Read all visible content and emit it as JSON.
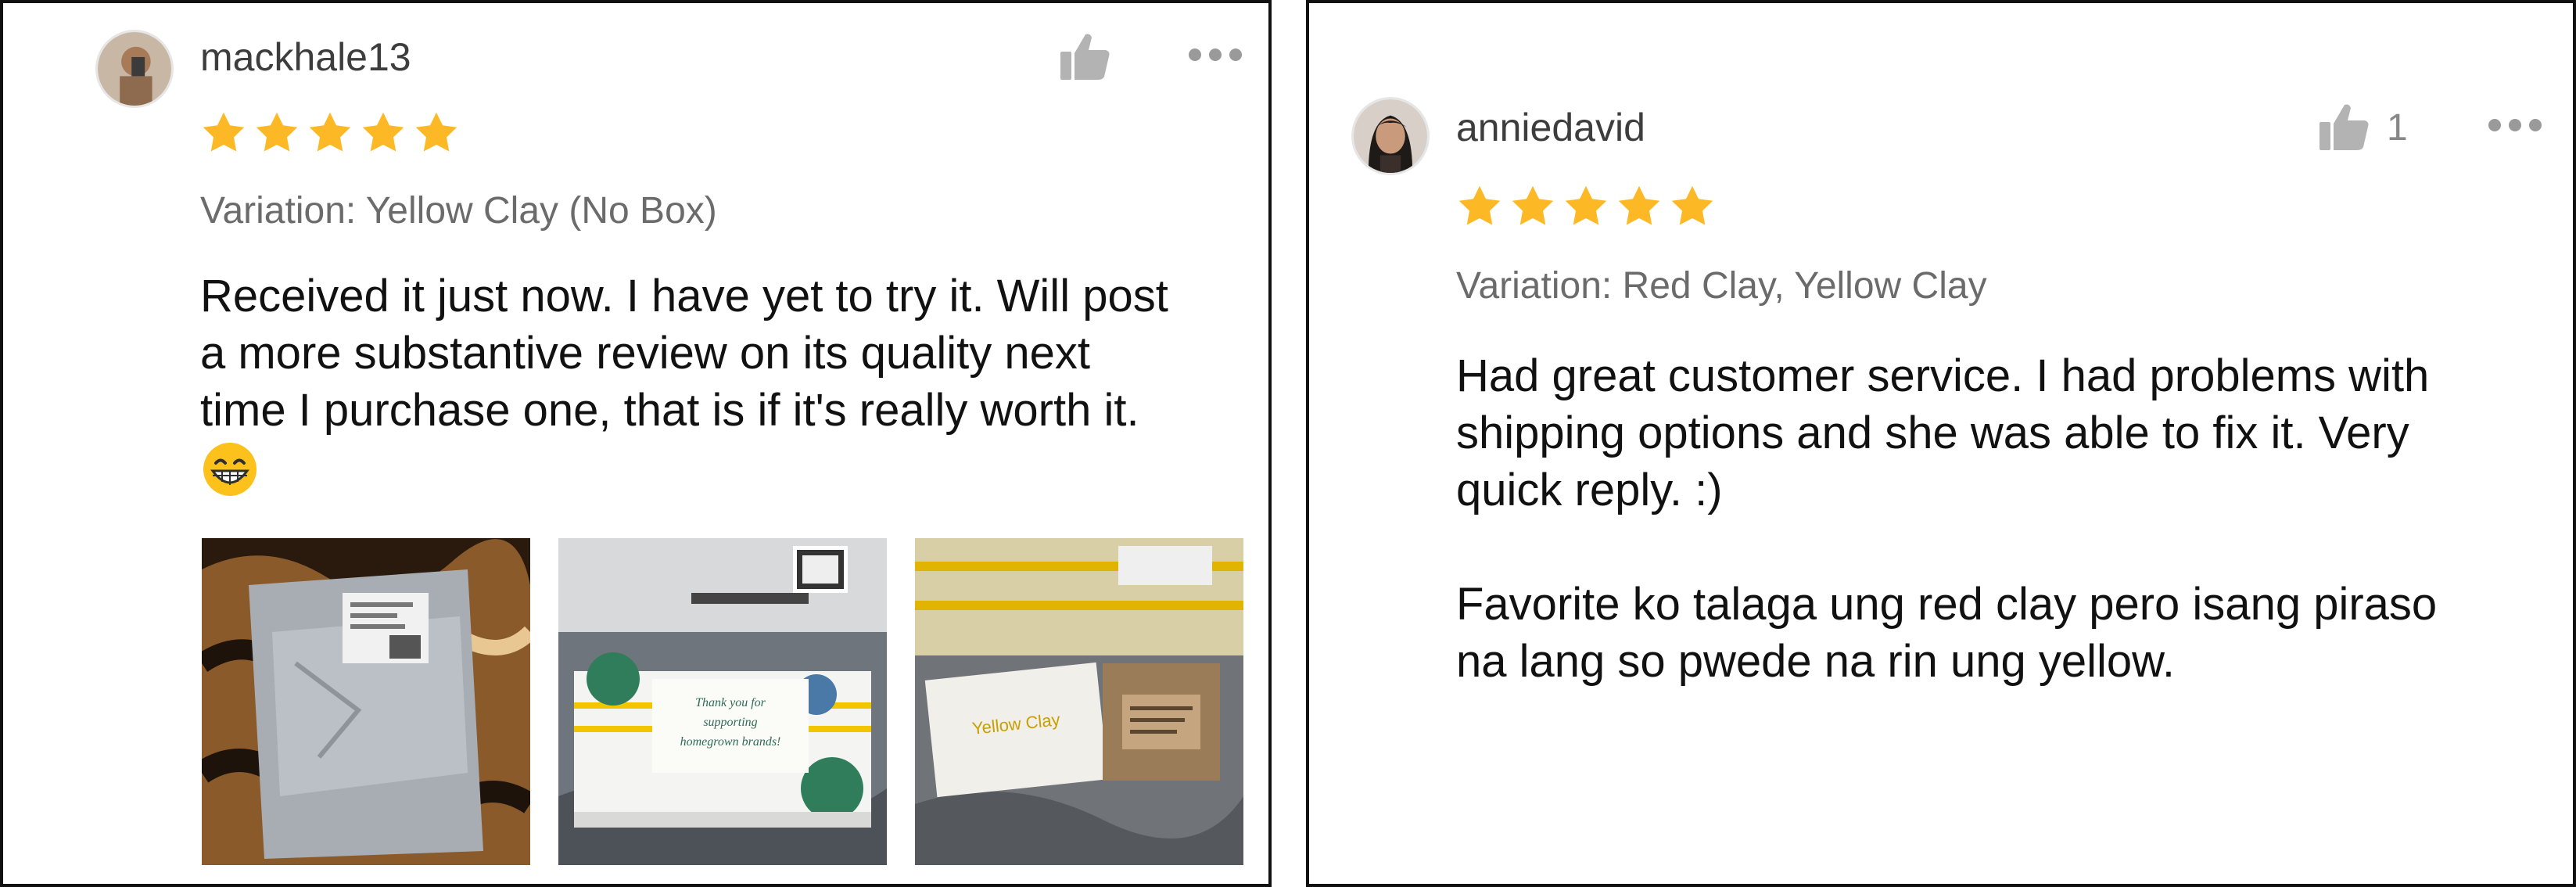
{
  "reviews": [
    {
      "username": "mackhale13",
      "rating": 5,
      "like_count": "",
      "variation": "Variation: Yellow Clay (No Box)",
      "text": "Received it just now. I have yet to try it. Will post\na more substantive review on its quality next\ntime I purchase one, that is if it's really worth it.",
      "emoji": "grinning-face-with-smiling-eyes",
      "photos": [
        {
          "name": "photo-silver-mailer-bag"
        },
        {
          "name": "photo-box-thank-you",
          "caption": "Thank you for supporting homegrown brands!"
        },
        {
          "name": "photo-yellow-clay-boxes",
          "caption": "Yellow Clay"
        }
      ]
    },
    {
      "username": "anniedavid",
      "rating": 5,
      "like_count": "1",
      "variation": "Variation: Red Clay, Yellow Clay",
      "text": "Had great customer service. I had problems with\nshipping options and she was able to fix it. Very\nquick reply. :)\n\nFavorite ko talaga ung red clay pero isang piraso\nna lang so pwede na rin ung yellow."
    }
  ],
  "colors": {
    "star": "#FDB925",
    "like_icon": "#b3b3b3",
    "username": "#3d3d3d",
    "variation": "#6b6b6b"
  }
}
